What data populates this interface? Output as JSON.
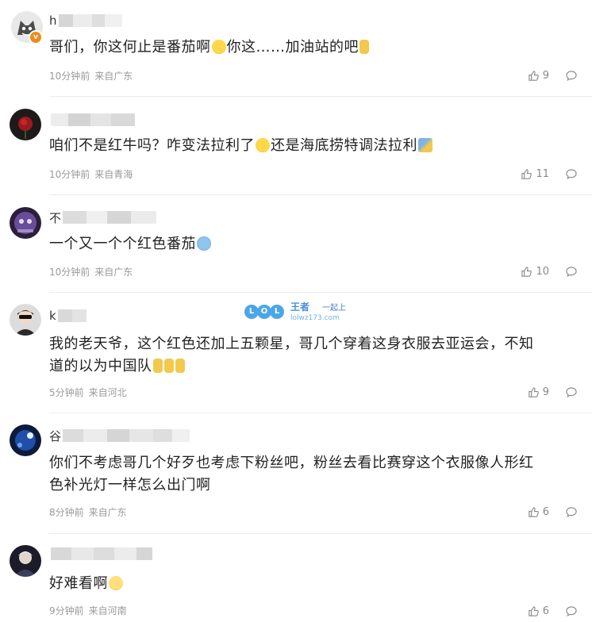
{
  "comments": [
    {
      "name_visible": "h",
      "text": "哥们，你这何止是番茄啊",
      "text2": "你这……加油站的吧",
      "time": "10分钟前",
      "location": "来自广东",
      "likes": "9",
      "verified_badge": "v"
    },
    {
      "name_visible": "",
      "text": "咱们不是红牛吗？咋变法拉利了",
      "text2": "还是海底捞特调法拉利",
      "time": "10分钟前",
      "location": "来自青海",
      "likes": "11"
    },
    {
      "name_visible": "不",
      "text": "一个又一个个红色番茄",
      "time": "10分钟前",
      "location": "来自广东",
      "likes": "10"
    },
    {
      "name_visible": "k",
      "text": "我的老天爷，这个红色还加上五颗星，哥几个穿着这身衣服去亚运会，不知",
      "text2": "道的以为中国队",
      "time": "5分钟前",
      "location": "来自河北",
      "likes": "9"
    },
    {
      "name_visible": "谷",
      "text": "你们不考虑哥几个好歹也考虑下粉丝吧，粉丝去看比赛穿这个衣服像人形红",
      "text2": "色补光灯一样怎么出门啊",
      "time": "8分钟前",
      "location": "来自广东",
      "likes": "6"
    },
    {
      "name_visible": "",
      "text": "好难看啊",
      "time": "9分钟前",
      "location": "来自河南",
      "likes": "6"
    }
  ],
  "watermark": {
    "letters": [
      "L",
      "O",
      "L"
    ],
    "brand": "王者",
    "tag": "一起上",
    "url": "lolwz173.com"
  },
  "icons": {
    "like": "thumbs-up-icon",
    "reply": "comment-bubble-icon"
  },
  "colors": {
    "meta": "#9a9a9a",
    "badge": "#f08a1c",
    "text": "#222222"
  }
}
